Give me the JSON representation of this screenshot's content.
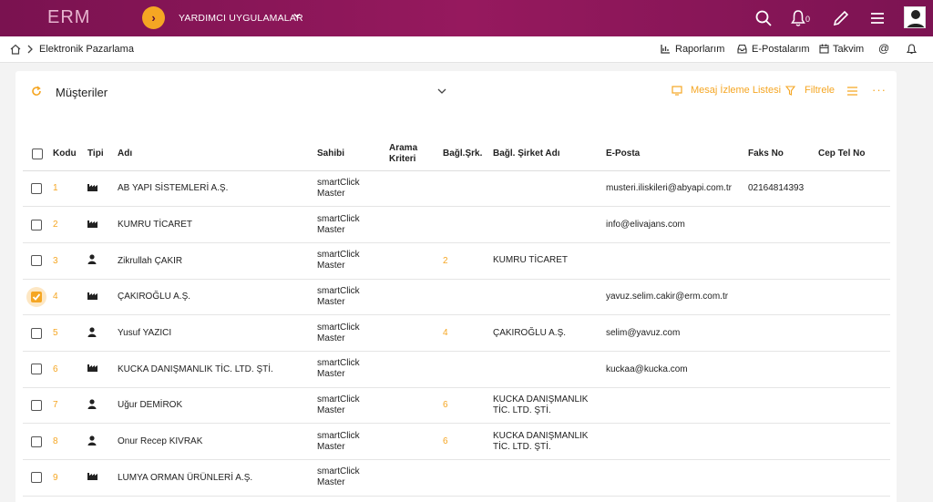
{
  "app": {
    "logo": "ERM",
    "apps_label": "YARDIMCI UYGULAMALAR",
    "notif_count": "0"
  },
  "breadcrumb": {
    "current": "Elektronik Pazarlama"
  },
  "subnav": {
    "reports": "Raporlarım",
    "emails": "E-Postalarım",
    "calendar": "Takvim"
  },
  "panel": {
    "title": "Müşteriler",
    "message_list": "Mesaj İzleme Listesi",
    "filter": "Filtrele"
  },
  "columns": {
    "code": "Kodu",
    "type": "Tipi",
    "name": "Adı",
    "owner": "Sahibi",
    "search_l1": "Arama",
    "search_l2": "Kriteri",
    "linked": "Bağl.Şrk.",
    "linked_name": "Bağl. Şirket Adı",
    "email": "E-Posta",
    "fax": "Faks No",
    "mobile": "Cep Tel No"
  },
  "rows": [
    {
      "code": "1",
      "type": "company",
      "name": "AB YAPI SİSTEMLERİ A.Ş.",
      "owner1": "smartClick",
      "owner2": "Master",
      "linked": "",
      "linked_name1": "",
      "linked_name2": "",
      "email": "musteri.iliskileri@abyapi.com.tr",
      "fax": "02164814393",
      "checked": false
    },
    {
      "code": "2",
      "type": "company",
      "name": "KUMRU TİCARET",
      "owner1": "smartClick",
      "owner2": "Master",
      "linked": "",
      "linked_name1": "",
      "linked_name2": "",
      "email": "info@elivajans.com",
      "fax": "",
      "checked": false
    },
    {
      "code": "3",
      "type": "person",
      "name": "Zikrullah ÇAKIR",
      "owner1": "smartClick",
      "owner2": "Master",
      "linked": "2",
      "linked_name1": "KUMRU TİCARET",
      "linked_name2": "",
      "email": "",
      "fax": "",
      "checked": false
    },
    {
      "code": "4",
      "type": "company",
      "name": "ÇAKIROĞLU A.Ş.",
      "owner1": "smartClick",
      "owner2": "Master",
      "linked": "",
      "linked_name1": "",
      "linked_name2": "",
      "email": "yavuz.selim.cakir@erm.com.tr",
      "fax": "",
      "checked": true
    },
    {
      "code": "5",
      "type": "person",
      "name": "Yusuf YAZICI",
      "owner1": "smartClick",
      "owner2": "Master",
      "linked": "4",
      "linked_name1": "ÇAKIROĞLU A.Ş.",
      "linked_name2": "",
      "email": "selim@yavuz.com",
      "fax": "",
      "checked": false
    },
    {
      "code": "6",
      "type": "company",
      "name": "KUCKA DANIŞMANLIK TİC. LTD. ŞTİ.",
      "owner1": "smartClick",
      "owner2": "Master",
      "linked": "",
      "linked_name1": "",
      "linked_name2": "",
      "email": "kuckaa@kucka.com",
      "fax": "",
      "checked": false
    },
    {
      "code": "7",
      "type": "person",
      "name": "Uğur DEMİROK",
      "owner1": "smartClick",
      "owner2": "Master",
      "linked": "6",
      "linked_name1": "KUCKA DANIŞMANLIK",
      "linked_name2": "TİC. LTD. ŞTİ.",
      "email": "",
      "fax": "",
      "checked": false
    },
    {
      "code": "8",
      "type": "person",
      "name": "Onur Recep KIVRAK",
      "owner1": "smartClick",
      "owner2": "Master",
      "linked": "6",
      "linked_name1": "KUCKA DANIŞMANLIK",
      "linked_name2": "TİC. LTD. ŞTİ.",
      "email": "",
      "fax": "",
      "checked": false
    },
    {
      "code": "9",
      "type": "company",
      "name": "LUMYA ORMAN ÜRÜNLERİ A.Ş.",
      "owner1": "smartClick",
      "owner2": "Master",
      "linked": "",
      "linked_name1": "",
      "linked_name2": "",
      "email": "",
      "fax": "",
      "checked": false
    }
  ]
}
